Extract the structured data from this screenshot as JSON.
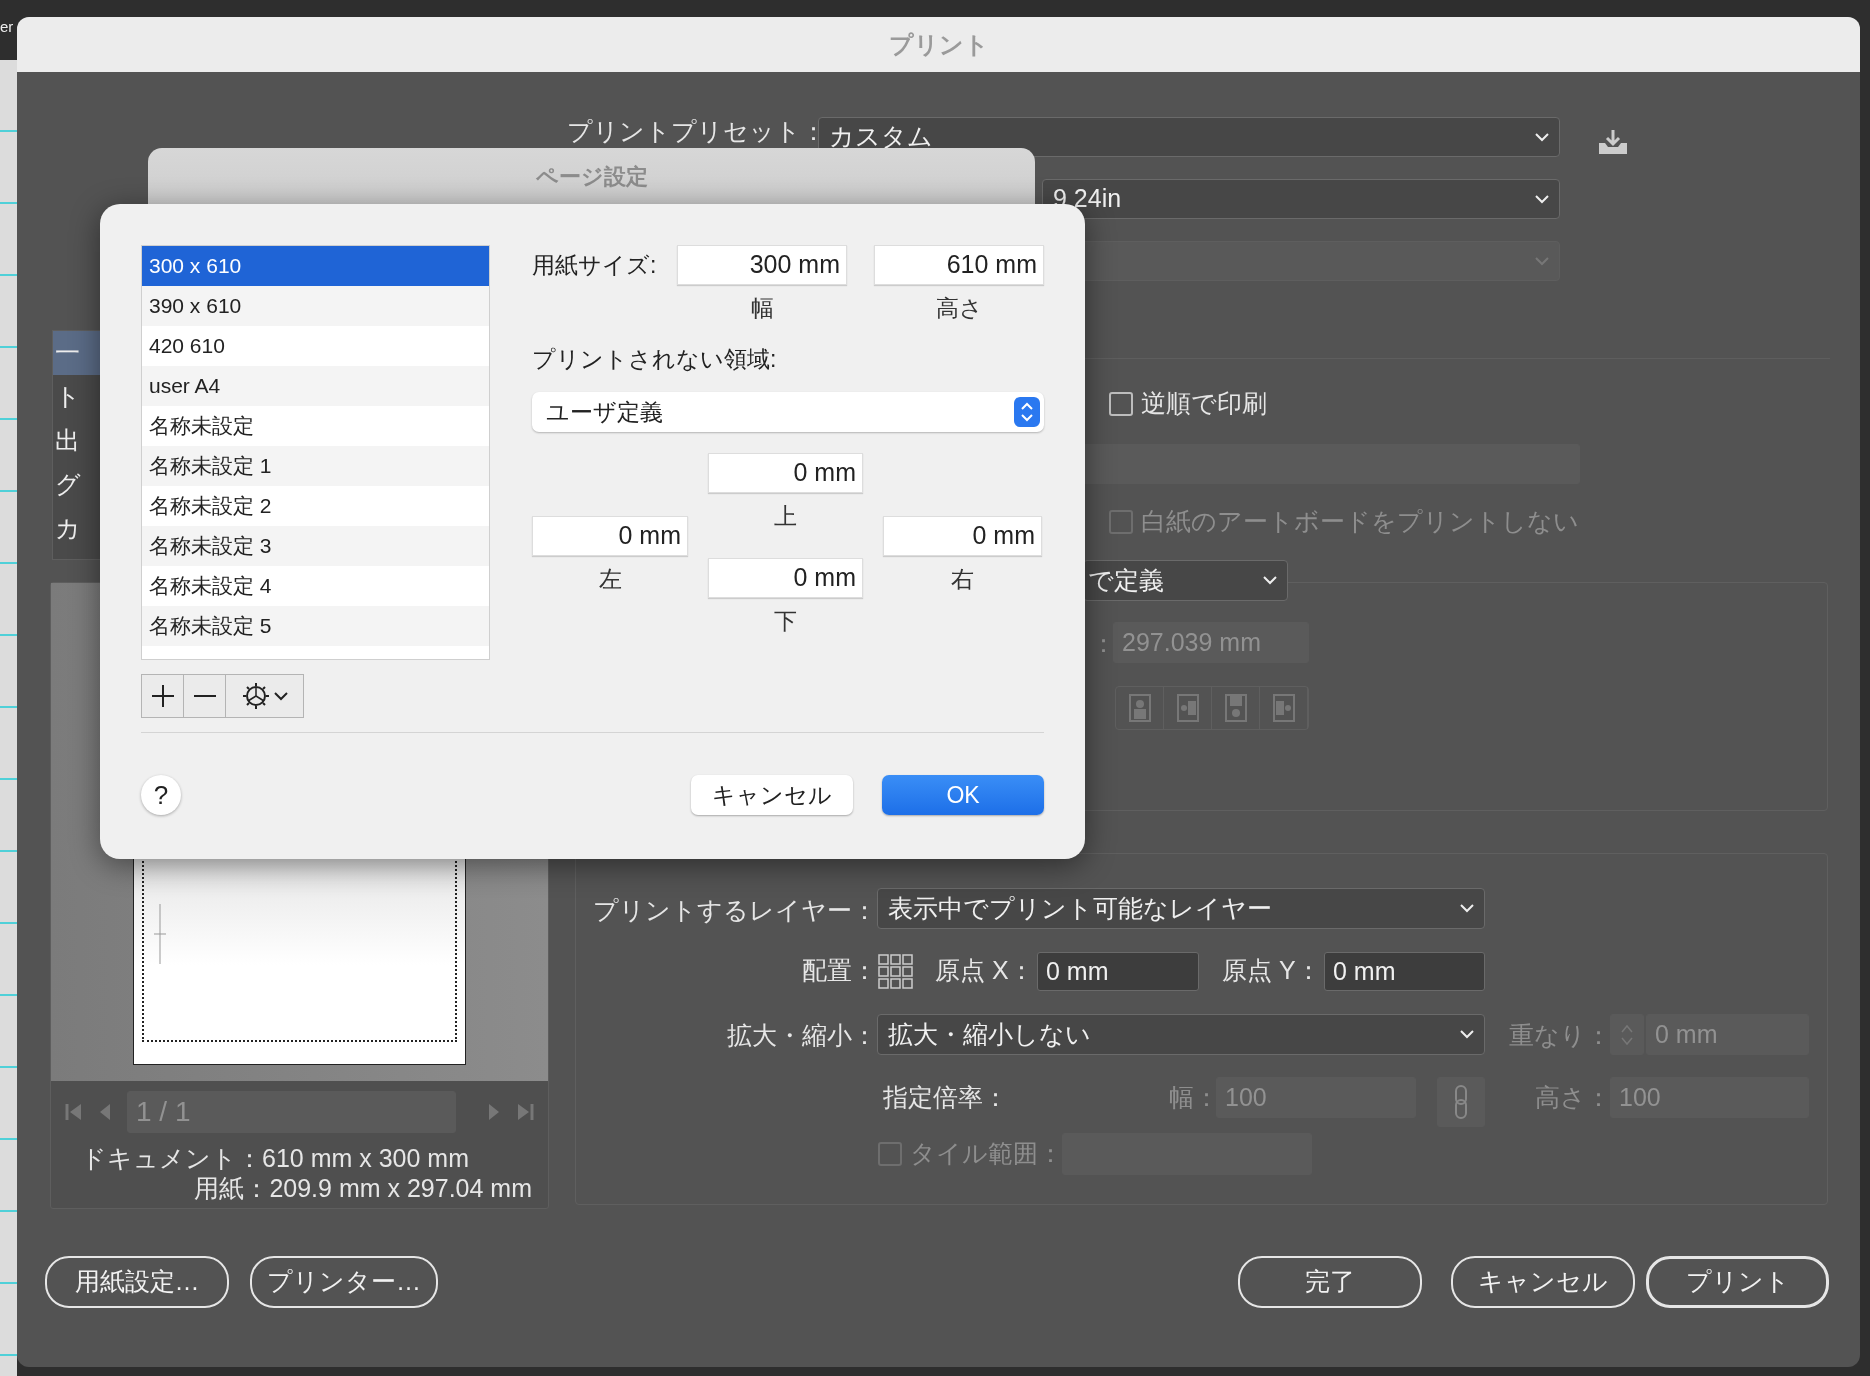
{
  "background": {
    "title_fragment": "er"
  },
  "print_window": {
    "title": "プリント",
    "preset": {
      "label": "プリントプリセット：",
      "value": "カスタム"
    },
    "printer": {
      "value": "9 24in"
    },
    "ppd": {
      "disabled": true
    },
    "sidebar": {
      "items": [
        {
          "label": "一",
          "selected": true
        },
        {
          "label": "ト",
          "selected": false
        },
        {
          "label": "出",
          "selected": false
        },
        {
          "label": "グ",
          "selected": false
        },
        {
          "label": "カ",
          "selected": false
        }
      ]
    },
    "reverse_order": {
      "label": "逆順で印刷",
      "checked": false,
      "disabled": false
    },
    "range": {
      "disabled": true
    },
    "skip_blank": {
      "label": "白紙のアートボードをプリントしない",
      "checked": false,
      "disabled": true
    },
    "media": {
      "value": "で定義"
    },
    "media_height": {
      "separator": "：",
      "value": "297.039 mm",
      "disabled": true
    },
    "preview": {
      "page_nav": "1 / 1",
      "document": "ドキュメント：610 mm x 300 mm",
      "paper": "用紙：209.9 mm x 297.04 mm"
    },
    "options": {
      "layers": {
        "label": "プリントするレイヤー：",
        "value": "表示中でプリント可能なレイヤー"
      },
      "placement": {
        "label": "配置："
      },
      "origin_x": {
        "label": "原点 X：",
        "value": "0 mm"
      },
      "origin_y": {
        "label": "原点 Y：",
        "value": "0 mm"
      },
      "scaling": {
        "label": "拡大・縮小：",
        "value": "拡大・縮小しない"
      },
      "overlap": {
        "label": "重なり：",
        "value": "0 mm",
        "disabled": true
      },
      "custom_scale": {
        "label": "指定倍率："
      },
      "scale_width": {
        "label": "幅：",
        "value": "100",
        "disabled": true
      },
      "scale_height": {
        "label": "高さ：",
        "value": "100",
        "disabled": true
      },
      "tile": {
        "label": "タイル範囲：",
        "checked": false,
        "disabled": true
      }
    },
    "buttons": [
      {
        "label": "用紙設定…",
        "kind": "normal"
      },
      {
        "label": "プリンター…",
        "kind": "normal"
      },
      {
        "label": "完了",
        "kind": "normal"
      },
      {
        "label": "キャンセル",
        "kind": "normal"
      },
      {
        "label": "プリント",
        "kind": "default"
      }
    ]
  },
  "page_setup_sheet": {
    "title": "ページ設定"
  },
  "paper_dialog": {
    "sizes": [
      {
        "label": "300 x 610",
        "selected": true
      },
      {
        "label": "390 x 610",
        "selected": false
      },
      {
        "label": "420 610",
        "selected": false
      },
      {
        "label": "user A4",
        "selected": false
      },
      {
        "label": "名称未設定",
        "selected": false
      },
      {
        "label": "名称未設定 1",
        "selected": false
      },
      {
        "label": "名称未設定 2",
        "selected": false
      },
      {
        "label": "名称未設定 3",
        "selected": false
      },
      {
        "label": "名称未設定 4",
        "selected": false
      },
      {
        "label": "名称未設定 5",
        "selected": false
      }
    ],
    "paper_size_label": "用紙サイズ:",
    "width": {
      "value": "300 mm",
      "caption": "幅"
    },
    "height": {
      "value": "610 mm",
      "caption": "高さ"
    },
    "nonprintable": {
      "label": "プリントされない領域:",
      "value": "ユーザ定義"
    },
    "margins": {
      "top": {
        "value": "0 mm",
        "caption": "上"
      },
      "left": {
        "value": "0 mm",
        "caption": "左"
      },
      "right": {
        "value": "0 mm",
        "caption": "右"
      },
      "bottom": {
        "value": "0 mm",
        "caption": "下"
      }
    },
    "help": "?",
    "buttons": [
      {
        "label": "キャンセル",
        "kind": "normal"
      },
      {
        "label": "OK",
        "kind": "default"
      }
    ]
  }
}
